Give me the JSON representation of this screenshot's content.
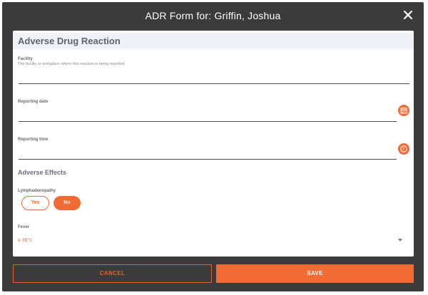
{
  "modal": {
    "title": "ADR Form for: Griffin, Joshua"
  },
  "form": {
    "section_title": "Adverse Drug Reaction",
    "facility": {
      "label": "Facility",
      "hint": "The facility or workplace where this reaction is being reported.",
      "value": ""
    },
    "reporting_date": {
      "label": "Reporting date",
      "value": ""
    },
    "reporting_time": {
      "label": "Reporting time",
      "value": ""
    },
    "effects_title": "Adverse Effects",
    "lymphadenopathy": {
      "label": "Lymphadenopathy",
      "options": [
        "Yes",
        "No"
      ],
      "selected": "No"
    },
    "fever": {
      "label": "Fever",
      "selected_value": "≥ 38°c"
    }
  },
  "footer": {
    "cancel_label": "CANCEL",
    "save_label": "SAVE"
  },
  "colors": {
    "accent": "#f26b35",
    "modal_bg": "#3b3b3b",
    "section_bg": "#eef1f6"
  },
  "icons": [
    "close-icon",
    "calendar-icon",
    "clock-icon",
    "chevron-down-icon"
  ]
}
